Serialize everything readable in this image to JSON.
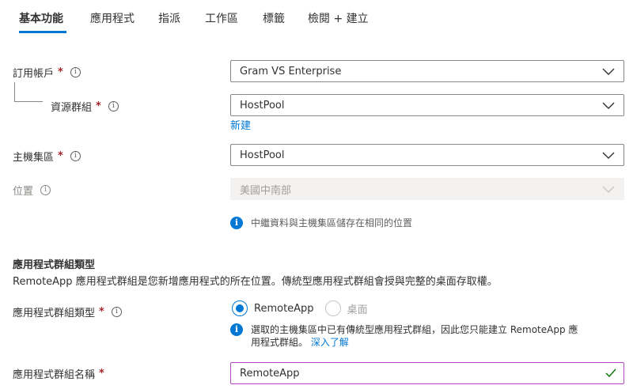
{
  "tabs": [
    {
      "label": "基本功能",
      "active": true
    },
    {
      "label": "應用程式"
    },
    {
      "label": "指派"
    },
    {
      "label": "工作區"
    },
    {
      "label": "標籤"
    },
    {
      "label": "檢閱 + 建立"
    }
  ],
  "colors": {
    "accent": "#0078d4",
    "required": "#a4262c",
    "valid_border": "#b146c2",
    "valid_check": "#107c10"
  },
  "form": {
    "subscription": {
      "label": "訂用帳戶",
      "required": "*",
      "info_icon": "info-icon",
      "value": "Gram VS Enterprise"
    },
    "resource_group": {
      "label": "資源群組",
      "required": "*",
      "info_icon": "info-icon",
      "value": "HostPool",
      "create_new": "新建"
    },
    "host_pool": {
      "label": "主機集區",
      "required": "*",
      "info_icon": "info-icon",
      "value": "HostPool"
    },
    "location": {
      "label": "位置",
      "info_icon": "info-icon",
      "value": "美國中南部",
      "disabled": true,
      "note": "中繼資料與主機集區儲存在相同的位置"
    }
  },
  "app_group_section": {
    "title": "應用程式群組類型",
    "description": "RemoteApp 應用程式群組是您新增應用程式的所在位置。傳統型應用程式群組會授與完整的桌面存取權。",
    "type_field": {
      "label": "應用程式群組類型",
      "required": "*",
      "options": [
        {
          "label": "RemoteApp",
          "selected": true
        },
        {
          "label": "桌面",
          "selected": false,
          "disabled": true
        }
      ],
      "note_line1": "選取的主機集區中已有傳統型應用程式群組，因此您只能建立 RemoteApp 應",
      "note_line2": "用程式群組。",
      "learn_more": "深入了解"
    },
    "name_field": {
      "label": "應用程式群組名稱",
      "required": "*",
      "value": "RemoteApp",
      "valid": true
    }
  }
}
